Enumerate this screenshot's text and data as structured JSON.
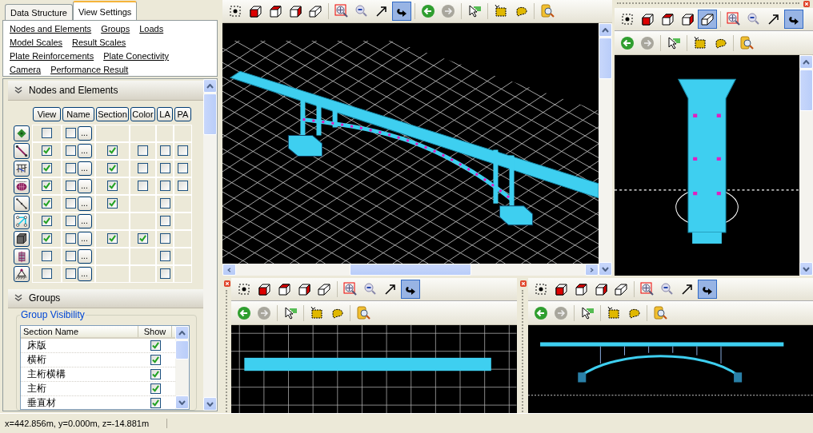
{
  "left_panel": {
    "tabs": [
      {
        "label": "Data Structure",
        "selected": false
      },
      {
        "label": "View Settings",
        "selected": true
      }
    ],
    "links": [
      [
        "Nodes and Elements",
        "Groups",
        "Loads"
      ],
      [
        "Model Scales",
        "Result Scales"
      ],
      [
        "Plate Reinforcements",
        "Plate Conectivity"
      ],
      [
        "Camera",
        "Performance Result"
      ]
    ],
    "nodes_section": {
      "title": "Nodes and Elements",
      "expanded": true,
      "columns": [
        "View",
        "Name",
        "Section",
        "Color",
        "LA",
        "PA"
      ],
      "rows": [
        {
          "kind": "node",
          "view": false,
          "name": false,
          "more": "..."
        },
        {
          "kind": "beam",
          "view": true,
          "name": false,
          "more": "...",
          "section": true,
          "color": false,
          "la": false,
          "pa": false
        },
        {
          "kind": "truss",
          "view": true,
          "name": false,
          "more": "...",
          "section": true,
          "color": false,
          "la": false,
          "pa": false
        },
        {
          "kind": "plate",
          "view": true,
          "name": false,
          "more": "...",
          "section": true,
          "color": false,
          "la": false,
          "pa": false
        },
        {
          "kind": "line",
          "view": true,
          "name": false,
          "more": "...",
          "section": true,
          "la": false
        },
        {
          "kind": "frame",
          "view": true,
          "name": false,
          "more": "...",
          "la": false
        },
        {
          "kind": "solid",
          "view": true,
          "name": false,
          "more": "...",
          "section": true,
          "color": true,
          "la": false
        },
        {
          "kind": "wall",
          "view": false,
          "name": false,
          "more": "...",
          "la": false
        },
        {
          "kind": "support",
          "view": false,
          "name": false,
          "more": "...",
          "la": false
        }
      ]
    },
    "groups_section": {
      "title": "Groups",
      "expanded": true,
      "legend": "Group Visibility",
      "columns": [
        "Section Name",
        "Show"
      ],
      "rows": [
        {
          "name": "床版",
          "show": true
        },
        {
          "name": "横桁",
          "show": true
        },
        {
          "name": "主桁横構",
          "show": true
        },
        {
          "name": "主桁",
          "show": true
        },
        {
          "name": "垂直材",
          "show": true
        }
      ]
    }
  },
  "viewports": [
    {
      "kind": "perspective",
      "closable": false,
      "toolbar_rows": [
        [
          {
            "kind": "points",
            "selected": false
          },
          {
            "kind": "front",
            "selected": false
          },
          {
            "kind": "top",
            "selected": false
          },
          {
            "kind": "side",
            "selected": false
          },
          {
            "kind": "iso",
            "selected": false
          },
          {
            "kind": "zoom-window",
            "selected": false
          },
          {
            "kind": "zoom-out",
            "selected": false
          },
          {
            "kind": "arrow",
            "selected": false
          },
          {
            "kind": "rotate",
            "selected": true
          },
          {
            "kind": "back",
            "selected": false
          },
          {
            "kind": "forward",
            "selected": false
          },
          {
            "kind": "select",
            "selected": false
          },
          {
            "kind": "select-rect",
            "selected": false
          },
          {
            "kind": "select-lasso",
            "selected": false
          },
          {
            "kind": "find",
            "selected": false
          }
        ]
      ]
    },
    {
      "kind": "end",
      "closable": true,
      "toolbar_rows": [
        [
          {
            "kind": "points",
            "selected": false
          },
          {
            "kind": "front",
            "selected": false
          },
          {
            "kind": "top",
            "selected": false
          },
          {
            "kind": "side",
            "selected": false
          },
          {
            "kind": "iso",
            "selected": true
          },
          {
            "kind": "zoom-window",
            "selected": false
          },
          {
            "kind": "zoom-out",
            "selected": false
          },
          {
            "kind": "arrow",
            "selected": false
          },
          {
            "kind": "rotate",
            "selected": true
          }
        ],
        [
          {
            "kind": "back",
            "selected": false
          },
          {
            "kind": "forward",
            "selected": false
          },
          {
            "kind": "select",
            "selected": false
          },
          {
            "kind": "select-rect",
            "selected": false
          },
          {
            "kind": "select-lasso",
            "selected": false
          },
          {
            "kind": "find",
            "selected": false
          }
        ]
      ]
    },
    {
      "kind": "plan",
      "closable": true,
      "toolbar_rows": [
        [
          {
            "kind": "points",
            "selected": false
          },
          {
            "kind": "front",
            "selected": false
          },
          {
            "kind": "top",
            "selected": false
          },
          {
            "kind": "side",
            "selected": false
          },
          {
            "kind": "iso",
            "selected": false
          },
          {
            "kind": "zoom-window",
            "selected": false
          },
          {
            "kind": "zoom-out",
            "selected": false
          },
          {
            "kind": "arrow",
            "selected": false
          },
          {
            "kind": "rotate",
            "selected": true
          }
        ],
        [
          {
            "kind": "back",
            "selected": false
          },
          {
            "kind": "forward",
            "selected": false
          },
          {
            "kind": "select",
            "selected": false
          },
          {
            "kind": "select-rect",
            "selected": false
          },
          {
            "kind": "select-lasso",
            "selected": false
          },
          {
            "kind": "find",
            "selected": false
          }
        ]
      ]
    },
    {
      "kind": "elevation",
      "closable": true,
      "toolbar_rows": [
        [
          {
            "kind": "points",
            "selected": false
          },
          {
            "kind": "front",
            "selected": false
          },
          {
            "kind": "top",
            "selected": false
          },
          {
            "kind": "side",
            "selected": false
          },
          {
            "kind": "iso",
            "selected": false
          },
          {
            "kind": "zoom-window",
            "selected": false
          },
          {
            "kind": "zoom-out",
            "selected": false
          },
          {
            "kind": "arrow",
            "selected": false
          },
          {
            "kind": "rotate",
            "selected": true
          }
        ],
        [
          {
            "kind": "back",
            "selected": false
          },
          {
            "kind": "forward",
            "selected": false
          },
          {
            "kind": "select",
            "selected": false
          },
          {
            "kind": "select-rect",
            "selected": false
          },
          {
            "kind": "select-lasso",
            "selected": false
          },
          {
            "kind": "find",
            "selected": false
          }
        ]
      ]
    }
  ],
  "status_bar": {
    "coordinates": "x=442.856m, y=0.000m, z=-14.881m"
  }
}
